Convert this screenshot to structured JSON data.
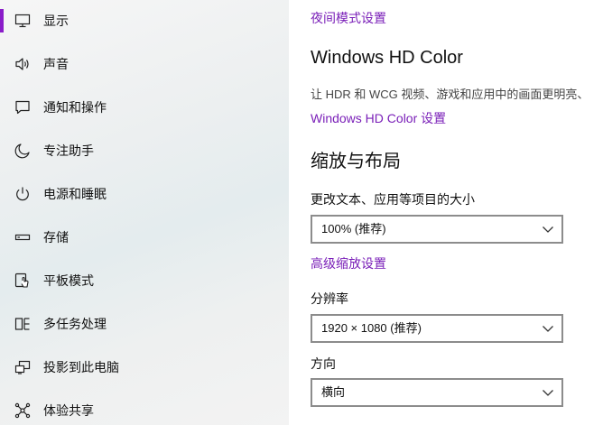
{
  "sidebar": {
    "accent_color": "#8a1cc9",
    "items": [
      {
        "label": "显示",
        "icon": "monitor-icon",
        "selected": true
      },
      {
        "label": "声音",
        "icon": "speaker-icon",
        "selected": false
      },
      {
        "label": "通知和操作",
        "icon": "notification-icon",
        "selected": false
      },
      {
        "label": "专注助手",
        "icon": "moon-icon",
        "selected": false
      },
      {
        "label": "电源和睡眠",
        "icon": "power-icon",
        "selected": false
      },
      {
        "label": "存储",
        "icon": "storage-icon",
        "selected": false
      },
      {
        "label": "平板模式",
        "icon": "tablet-mode-icon",
        "selected": false
      },
      {
        "label": "多任务处理",
        "icon": "multitasking-icon",
        "selected": false
      },
      {
        "label": "投影到此电脑",
        "icon": "project-icon",
        "selected": false
      },
      {
        "label": "体验共享",
        "icon": "share-icon",
        "selected": false
      }
    ]
  },
  "main": {
    "link_color": "#7a1fb8",
    "night_mode_link": "夜间模式设置",
    "hdr_title": "Windows HD Color",
    "hdr_description": "让 HDR 和 WCG 视频、游戏和应用中的画面更明亮、",
    "hdr_link": "Windows HD Color 设置",
    "scale_title": "缩放与布局",
    "scale_label": "更改文本、应用等项目的大小",
    "scale_value": "100% (推荐)",
    "advanced_scaling_link": "高级缩放设置",
    "resolution_label": "分辨率",
    "resolution_value": "1920 × 1080 (推荐)",
    "orientation_label": "方向",
    "orientation_value": "横向"
  }
}
